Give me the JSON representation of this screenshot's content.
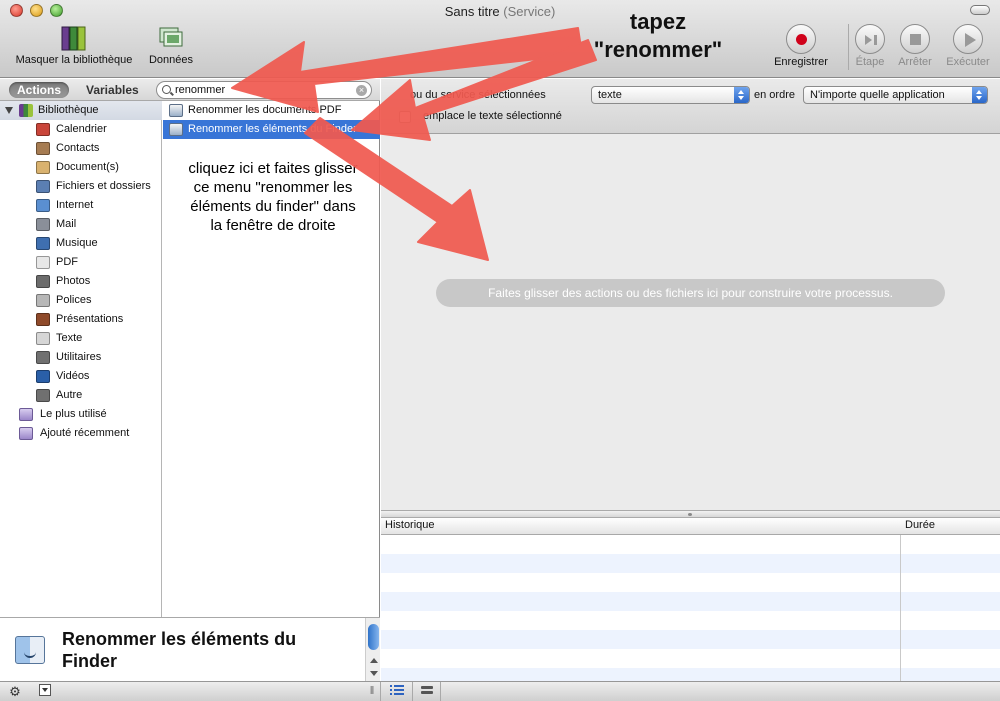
{
  "window": {
    "title": "Sans titre",
    "subtitle": "(Service)"
  },
  "toolbar": {
    "hide_library_label": "Masquer la bibliothèque",
    "data_label": "Données",
    "record_label": "Enregistrer",
    "step_label": "Étape",
    "stop_label": "Arrêter",
    "run_label": "Exécuter"
  },
  "library_tabs": {
    "actions_label": "Actions",
    "variables_label": "Variables"
  },
  "search": {
    "value": "renommer"
  },
  "library": {
    "root_label": "Bibliothèque",
    "items": [
      {
        "label": "Calendrier",
        "icon": "calendar-icon",
        "color": "#c9453a"
      },
      {
        "label": "Contacts",
        "icon": "contacts-icon",
        "color": "#a67c52"
      },
      {
        "label": "Document(s)",
        "icon": "document-icon",
        "color": "#d9b26f"
      },
      {
        "label": "Fichiers et dossiers",
        "icon": "folder-icon",
        "color": "#5b7fb3"
      },
      {
        "label": "Internet",
        "icon": "globe-icon",
        "color": "#5a8fd1"
      },
      {
        "label": "Mail",
        "icon": "mail-icon",
        "color": "#8a8f99"
      },
      {
        "label": "Musique",
        "icon": "music-icon",
        "color": "#3f6fb0"
      },
      {
        "label": "PDF",
        "icon": "pdf-icon",
        "color": "#e8e8e8"
      },
      {
        "label": "Photos",
        "icon": "photos-icon",
        "color": "#6c6c6c"
      },
      {
        "label": "Polices",
        "icon": "fonts-icon",
        "color": "#b7b7b7"
      },
      {
        "label": "Présentations",
        "icon": "presentations-icon",
        "color": "#8f4a2a"
      },
      {
        "label": "Texte",
        "icon": "text-icon",
        "color": "#d6d6d6"
      },
      {
        "label": "Utilitaires",
        "icon": "utilities-icon",
        "color": "#707070"
      },
      {
        "label": "Vidéos",
        "icon": "video-icon",
        "color": "#2a5fa8"
      },
      {
        "label": "Autre",
        "icon": "other-icon",
        "color": "#707070"
      }
    ],
    "smart_groups": [
      {
        "label": "Le plus utilisé",
        "icon": "smart-folder-icon"
      },
      {
        "label": "Ajouté récemment",
        "icon": "smart-folder-icon"
      }
    ]
  },
  "actions_list": [
    {
      "label": "Renommer les documents PDF",
      "selected": false
    },
    {
      "label": "Renommer les éléments du Finder",
      "selected": true
    }
  ],
  "annotations": {
    "drag_instruction": "cliquez ici et faites glisser ce menu \"renommer les éléments du finder\" dans la fenêtre de droite",
    "type_instruction_1": "tapez",
    "type_instruction_2": "\"renommer\""
  },
  "description": {
    "title": "Renommer les éléments du Finder"
  },
  "workflow_header": {
    "receives_text": "ou du service sélectionnées",
    "input_type": "texte",
    "in_label": "en ordre",
    "application": "N'importe quelle application",
    "replaces_text": "emplace le texte sélectionné"
  },
  "canvas": {
    "hint": "Faites glisser des actions ou des fichiers ici pour construire votre processus."
  },
  "log": {
    "col_history": "Historique",
    "col_duration": "Durée"
  },
  "colors": {
    "selection": "#3875d7",
    "arrow": "#f05a50",
    "record": "#d0021b"
  }
}
